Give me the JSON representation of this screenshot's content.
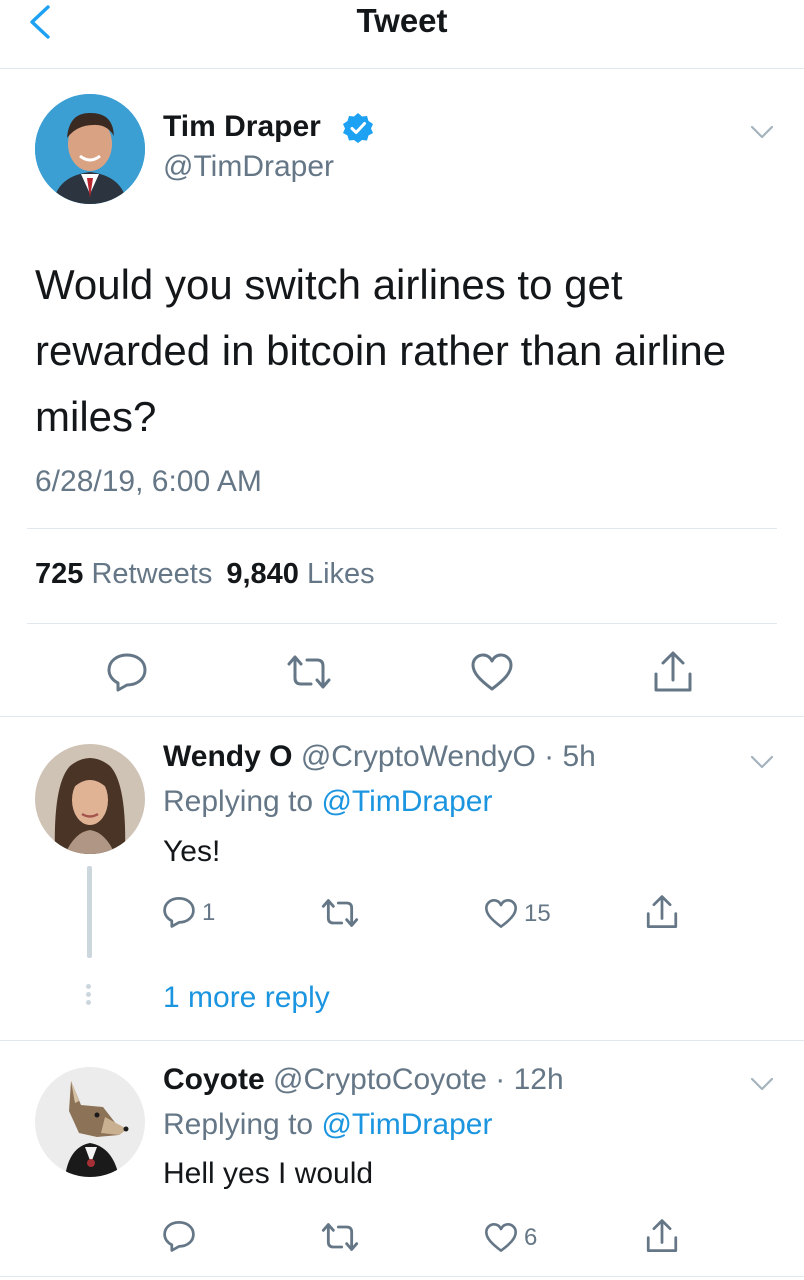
{
  "header": {
    "title": "Tweet",
    "back_icon": "chevron-left-icon"
  },
  "tweet": {
    "author_name": "Tim Draper",
    "author_handle": "@TimDraper",
    "verified": true,
    "text": "Would you switch airlines to get rewarded in bitcoin rather than airline miles?",
    "date": "6/28/19, 6:00 AM",
    "retweets": "725",
    "retweets_label": "Retweets",
    "likes": "9,840",
    "likes_label": "Likes"
  },
  "replies": [
    {
      "name": "Wendy O",
      "handle": "@CryptoWendyO",
      "time": "5h",
      "replying_prefix": "Replying to",
      "replying_to": "@TimDraper",
      "text": "Yes!",
      "reply_count": "1",
      "retweet_count": "",
      "like_count": "15",
      "more_replies": "1 more reply"
    },
    {
      "name": "Coyote",
      "handle": "@CryptoCoyote",
      "time": "12h",
      "replying_prefix": "Replying to",
      "replying_to": "@TimDraper",
      "text": "Hell yes I would",
      "reply_count": "",
      "retweet_count": "",
      "like_count": "6"
    }
  ],
  "colors": {
    "accent": "#1b95e0",
    "verified": "#1da1f2",
    "muted": "#657786",
    "border": "#e1e8ed"
  }
}
